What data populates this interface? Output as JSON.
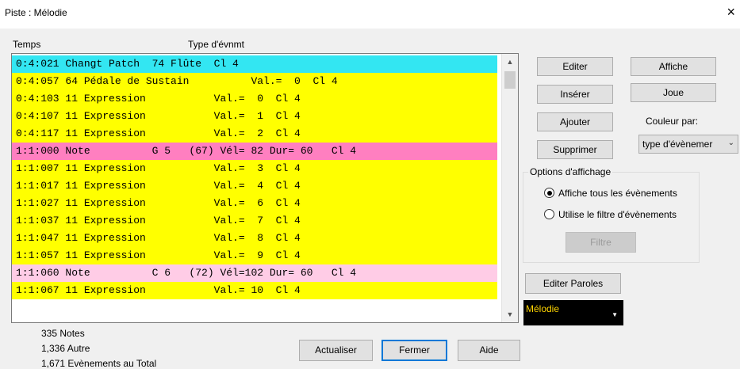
{
  "window": {
    "title": "Piste : Mélodie",
    "close": "×"
  },
  "headers": {
    "time": "Temps",
    "type": "Type d'évnmt"
  },
  "events": [
    {
      "text": "0:4:021 Changt Patch  74 Flûte  Cl 4",
      "kind": "sel"
    },
    {
      "text": "0:4:057 64 Pédale de Sustain          Val.=  0  Cl 4",
      "kind": "ctrl"
    },
    {
      "text": "0:4:103 11 Expression           Val.=  0  Cl 4",
      "kind": "ctrl"
    },
    {
      "text": "0:4:107 11 Expression           Val.=  1  Cl 4",
      "kind": "ctrl"
    },
    {
      "text": "0:4:117 11 Expression           Val.=  2  Cl 4",
      "kind": "ctrl"
    },
    {
      "text": "1:1:000 Note          G 5   (67) Vél= 82 Dur= 60   Cl 4",
      "kind": "note"
    },
    {
      "text": "1:1:007 11 Expression           Val.=  3  Cl 4",
      "kind": "ctrl"
    },
    {
      "text": "1:1:017 11 Expression           Val.=  4  Cl 4",
      "kind": "ctrl"
    },
    {
      "text": "1:1:027 11 Expression           Val.=  6  Cl 4",
      "kind": "ctrl"
    },
    {
      "text": "1:1:037 11 Expression           Val.=  7  Cl 4",
      "kind": "ctrl"
    },
    {
      "text": "1:1:047 11 Expression           Val.=  8  Cl 4",
      "kind": "ctrl"
    },
    {
      "text": "1:1:057 11 Expression           Val.=  9  Cl 4",
      "kind": "ctrl"
    },
    {
      "text": "1:1:060 Note          C 6   (72) Vél=102 Dur= 60   Cl 4",
      "kind": "notepale"
    },
    {
      "text": "1:1:067 11 Expression           Val.= 10  Cl 4",
      "kind": "ctrl"
    }
  ],
  "buttons": {
    "editer": "Editer",
    "affiche": "Affiche",
    "inserer": "Insérer",
    "joue": "Joue",
    "ajouter": "Ajouter",
    "supprimer": "Supprimer",
    "filtre": "Filtre",
    "editer_paroles": "Editer Paroles",
    "actualiser": "Actualiser",
    "fermer": "Fermer",
    "aide": "Aide"
  },
  "color_by": {
    "label": "Couleur par:",
    "value": "type d'évènemer"
  },
  "options": {
    "title": "Options d'affichage",
    "show_all": "Affiche tous les évènements",
    "use_filter": "Utilise le filtre d'évènements",
    "selected": "show_all"
  },
  "track_select": {
    "value": "Mélodie"
  },
  "stats": {
    "notes": "335 Notes",
    "other": "1,336 Autre",
    "total": "1,671 Evènements au Total"
  },
  "icons": {
    "scroll_up": "up-arrow-icon",
    "scroll_down": "down-arrow-icon",
    "dropdown": "chevron-down-icon"
  }
}
